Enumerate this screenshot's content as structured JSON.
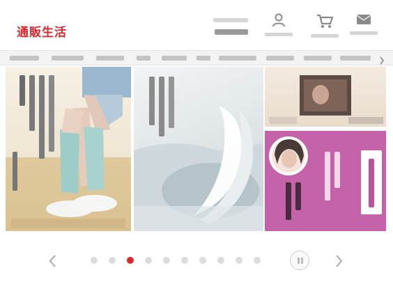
{
  "header": {
    "logo_text": "通販生活",
    "search_label": "",
    "search_value": "",
    "icons": [
      {
        "name": "mypage-icon",
        "label": ""
      },
      {
        "name": "cart-icon",
        "label": ""
      },
      {
        "name": "mail-icon",
        "label": ""
      }
    ]
  },
  "nav": {
    "items": [
      "",
      "",
      "",
      "",
      "",
      "",
      "",
      "",
      "",
      ""
    ]
  },
  "banner": {
    "slides": [
      {
        "name": "legs-slide",
        "caption": ""
      },
      {
        "name": "water-slide",
        "caption": ""
      },
      {
        "name": "video-slide",
        "caption": ""
      },
      {
        "name": "person-slide",
        "caption": ""
      }
    ]
  },
  "carousel": {
    "dot_count": 10,
    "active_index": 2,
    "colors": {
      "active": "#d8282e",
      "inactive": "#dcdcdc"
    }
  },
  "colors": {
    "brand": "#d8282e",
    "promo_pink": "#c463a9"
  }
}
